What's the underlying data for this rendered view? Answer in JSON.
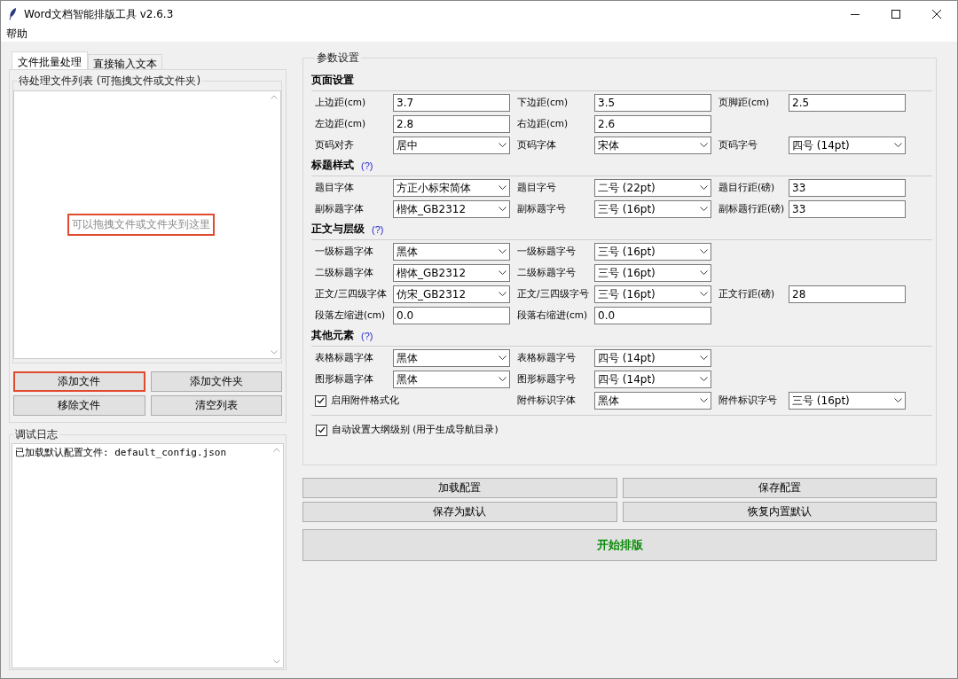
{
  "window": {
    "title": "Word文档智能排版工具 v2.6.3"
  },
  "menu": [
    "帮助"
  ],
  "left": {
    "tabs": [
      {
        "label": "文件批量处理",
        "selected": true
      },
      {
        "label": "直接输入文本",
        "selected": false
      }
    ],
    "file_list": {
      "legend": "待处理文件列表 (可拖拽文件或文件夹)",
      "placeholder": "可以拖拽文件或文件夹到这里",
      "highlighted": true
    },
    "file_buttons": [
      {
        "label": "添加文件",
        "highlighted": true
      },
      {
        "label": "添加文件夹",
        "highlighted": false
      },
      {
        "label": "移除文件",
        "highlighted": false
      },
      {
        "label": "清空列表",
        "highlighted": false
      }
    ],
    "log": {
      "legend": "调试日志",
      "lines": [
        "已加载默认配置文件: default_config.json"
      ]
    }
  },
  "settings": {
    "legend": "参数设置",
    "sections": [
      {
        "title": "页面设置",
        "rows": [
          [
            {
              "kind": "entry",
              "label": "上边距(cm)",
              "value": "3.7"
            },
            {
              "kind": "entry",
              "label": "下边距(cm)",
              "value": "3.5"
            },
            {
              "kind": "entry",
              "label": "页脚距(cm)",
              "value": "2.5"
            }
          ],
          [
            {
              "kind": "entry",
              "label": "左边距(cm)",
              "value": "2.8"
            },
            {
              "kind": "entry",
              "label": "右边距(cm)",
              "value": "2.6"
            }
          ],
          [
            {
              "kind": "combo",
              "label": "页码对齐",
              "value": "居中"
            },
            {
              "kind": "combo",
              "label": "页码字体",
              "value": "宋体"
            },
            {
              "kind": "combo",
              "label": "页码字号",
              "value": "四号 (14pt)"
            }
          ]
        ]
      },
      {
        "title": "标题样式",
        "help": "(?)",
        "rows": [
          [
            {
              "kind": "combo",
              "label": "题目字体",
              "value": "方正小标宋简体"
            },
            {
              "kind": "combo",
              "label": "题目字号",
              "value": "二号 (22pt)"
            },
            {
              "kind": "entry",
              "label": "题目行距(磅)",
              "value": "33"
            }
          ],
          [
            {
              "kind": "combo",
              "label": "副标题字体",
              "value": "楷体_GB2312"
            },
            {
              "kind": "combo",
              "label": "副标题字号",
              "value": "三号 (16pt)"
            },
            {
              "kind": "entry",
              "label": "副标题行距(磅)",
              "value": "33"
            }
          ]
        ]
      },
      {
        "title": "正文与层级",
        "help": "(?)",
        "rows": [
          [
            {
              "kind": "combo",
              "label": "一级标题字体",
              "value": "黑体"
            },
            {
              "kind": "combo",
              "label": "一级标题字号",
              "value": "三号 (16pt)"
            }
          ],
          [
            {
              "kind": "combo",
              "label": "二级标题字体",
              "value": "楷体_GB2312"
            },
            {
              "kind": "combo",
              "label": "二级标题字号",
              "value": "三号 (16pt)"
            }
          ],
          [
            {
              "kind": "combo",
              "label": "正文/三四级字体",
              "value": "仿宋_GB2312"
            },
            {
              "kind": "combo",
              "label": "正文/三四级字号",
              "value": "三号 (16pt)"
            },
            {
              "kind": "entry",
              "label": "正文行距(磅)",
              "value": "28"
            }
          ],
          [
            {
              "kind": "entry",
              "label": "段落左缩进(cm)",
              "value": "0.0"
            },
            {
              "kind": "entry",
              "label": "段落右缩进(cm)",
              "value": "0.0"
            }
          ]
        ]
      },
      {
        "title": "其他元素",
        "help": "(?)",
        "rows": [
          [
            {
              "kind": "combo",
              "label": "表格标题字体",
              "value": "黑体"
            },
            {
              "kind": "combo",
              "label": "表格标题字号",
              "value": "四号 (14pt)"
            }
          ],
          [
            {
              "kind": "combo",
              "label": "图形标题字体",
              "value": "黑体"
            },
            {
              "kind": "combo",
              "label": "图形标题字号",
              "value": "四号 (14pt)"
            }
          ],
          [
            {
              "kind": "checkbox",
              "label": "启用附件格式化",
              "checked": true
            },
            {
              "kind": "combo",
              "label": "附件标识字体",
              "value": "黑体"
            },
            {
              "kind": "combo",
              "label": "附件标识字号",
              "value": "三号 (16pt)"
            }
          ]
        ]
      }
    ],
    "outline": {
      "label": "自动设置大纲级别 (用于生成导航目录)",
      "checked": true
    }
  },
  "config_buttons": [
    "加载配置",
    "保存配置",
    "保存为默认",
    "恢复内置默认"
  ],
  "start_button": "开始排版"
}
